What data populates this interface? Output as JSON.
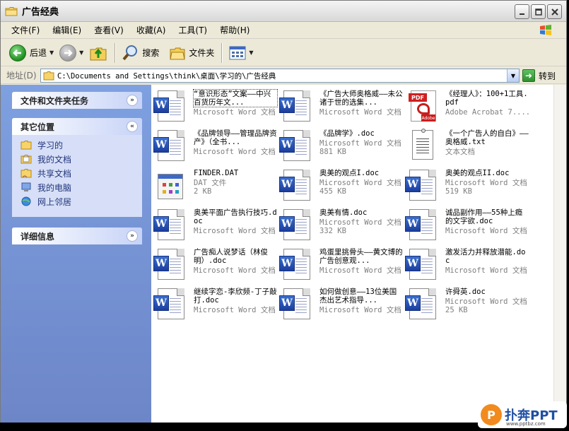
{
  "window": {
    "title": "广告经典"
  },
  "menu": [
    "文件(F)",
    "编辑(E)",
    "查看(V)",
    "收藏(A)",
    "工具(T)",
    "帮助(H)"
  ],
  "toolbar": {
    "back": "后退",
    "search": "搜索",
    "folders": "文件夹"
  },
  "address": {
    "label": "地址(D)",
    "path": "C:\\Documents and Settings\\think\\桌面\\学习的\\广告经典",
    "go": "转到"
  },
  "leftpane": {
    "tasks_title": "文件和文件夹任务",
    "places_title": "其它位置",
    "places": [
      {
        "label": "学习的",
        "icon": "folder-icon"
      },
      {
        "label": "我的文档",
        "icon": "my-documents-icon"
      },
      {
        "label": "共享文档",
        "icon": "shared-folder-icon"
      },
      {
        "label": "我的电脑",
        "icon": "my-computer-icon"
      },
      {
        "label": "网上邻居",
        "icon": "network-icon"
      }
    ],
    "details_title": "详细信息"
  },
  "files": [
    {
      "name": "“意识形态”文案——中兴百货历年文...",
      "type": "Microsoft Word 文档",
      "size": "",
      "icon": "word"
    },
    {
      "name": "《广告大师奥格威——未公诸于世的选集...",
      "type": "Microsoft Word 文档",
      "size": "",
      "icon": "word"
    },
    {
      "name": "《经理人》：100+1工具.pdf",
      "type": "Adobe Acrobat 7....",
      "size": "",
      "icon": "pdf"
    },
    {
      "name": "《品牌领导——管理品牌资产》（全书...",
      "type": "Microsoft Word 文档",
      "size": "",
      "icon": "word"
    },
    {
      "name": "《品牌学》.doc",
      "type": "Microsoft Word 文档",
      "size": "881 KB",
      "icon": "word"
    },
    {
      "name": "《一个广告人的自白》——奥格威.txt",
      "type": "文本文档",
      "size": "",
      "icon": "txt"
    },
    {
      "name": "FINDER.DAT",
      "type": "DAT 文件",
      "size": "2 KB",
      "icon": "dat"
    },
    {
      "name": "奥美的观点I.doc",
      "type": "Microsoft Word 文档",
      "size": "455 KB",
      "icon": "word"
    },
    {
      "name": "奥美的观点II.doc",
      "type": "Microsoft Word 文档",
      "size": "519 KB",
      "icon": "word"
    },
    {
      "name": "奥美平面广告执行技巧.doc",
      "type": "Microsoft Word 文档",
      "size": "",
      "icon": "word"
    },
    {
      "name": "奥美有情.doc",
      "type": "Microsoft Word 文档",
      "size": "332 KB",
      "icon": "word"
    },
    {
      "name": "诚品副作用——55种上瘾的文字欲.doc",
      "type": "Microsoft Word 文档",
      "size": "",
      "icon": "word"
    },
    {
      "name": "广告痴人说梦话（林俊明）.doc",
      "type": "Microsoft Word 文档",
      "size": "",
      "icon": "word"
    },
    {
      "name": "鸡蛋里挑骨头——黄文博的广告创意观...",
      "type": "Microsoft Word 文档",
      "size": "",
      "icon": "word"
    },
    {
      "name": "激发活力并释放潜能.doc",
      "type": "Microsoft Word 文档",
      "size": "",
      "icon": "word"
    },
    {
      "name": "继续字恋-李欣频-丁子敲打.doc",
      "type": "Microsoft Word 文档",
      "size": "",
      "icon": "word"
    },
    {
      "name": "如何做创意——13位美国杰出艺术指导...",
      "type": "Microsoft Word 文档",
      "size": "",
      "icon": "word"
    },
    {
      "name": "许舜英.doc",
      "type": "Microsoft Word 文档",
      "size": "25 KB",
      "icon": "word"
    }
  ],
  "watermark": {
    "brand": "扑奔PPT",
    "mark": "P",
    "url": "www.pptbz.com"
  }
}
